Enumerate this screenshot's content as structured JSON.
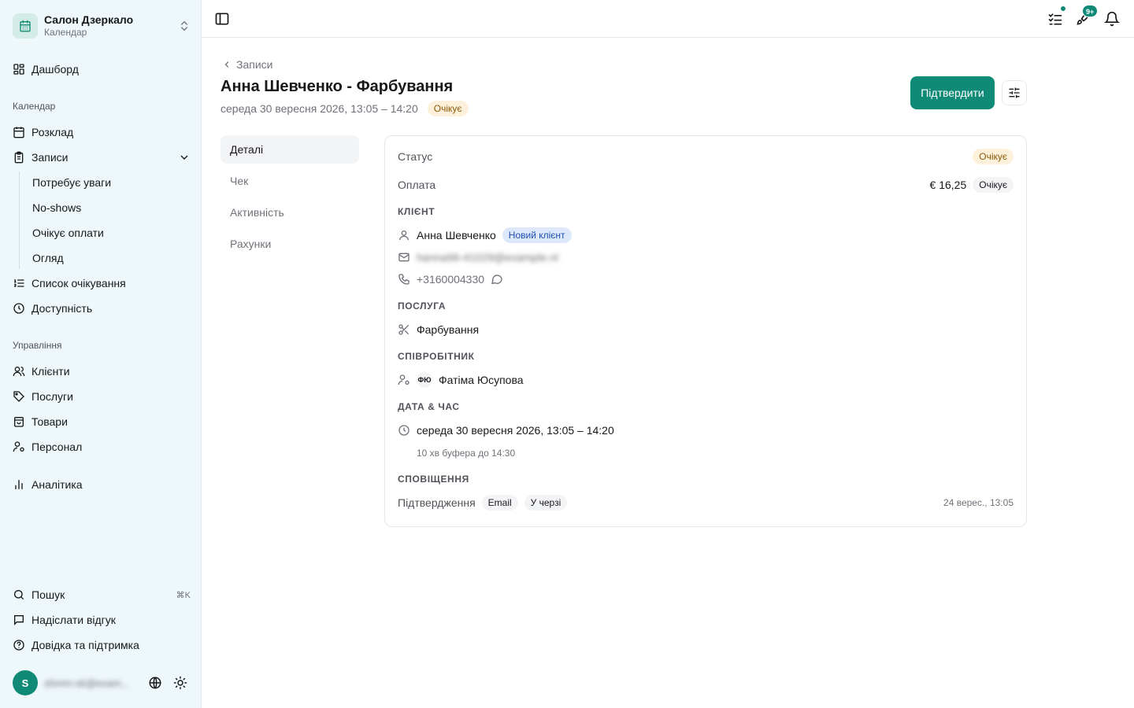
{
  "org": {
    "name": "Салон Дзеркало",
    "subtitle": "Календар"
  },
  "nav": {
    "dashboard": "Дашборд",
    "calendar_section": "Календар",
    "schedule": "Розклад",
    "records": "Записи",
    "records_sub": [
      "Потребує уваги",
      "No-shows",
      "Очікує оплати",
      "Огляд"
    ],
    "waitlist": "Список очікування",
    "availability": "Доступність",
    "manage_section": "Управління",
    "clients": "Клієнти",
    "services": "Послуги",
    "products": "Товари",
    "staff": "Персонал",
    "analytics": "Аналітика",
    "search": "Пошук",
    "search_kbd": "⌘K",
    "feedback": "Надіслати відгук",
    "help": "Довідка та підтримка"
  },
  "user": {
    "initial": "S",
    "email": "shmm-sk@exam..."
  },
  "topbar": {
    "notif_count": "9+"
  },
  "header": {
    "back_label": "Записи",
    "title": "Анна Шевченко - Фарбування",
    "datetime": "середа 30 вересня 2026, 13:05 – 14:20",
    "status": "Очікує",
    "confirm_label": "Підтвердити"
  },
  "tabs": [
    "Деталі",
    "Чек",
    "Активність",
    "Рахунки"
  ],
  "details": {
    "status_label": "Статус",
    "status_value": "Очікує",
    "payment_label": "Оплата",
    "payment_amount": "€ 16,25",
    "payment_status": "Очікує",
    "client_section": "КЛІЄНТ",
    "client_name": "Анна Шевченко",
    "client_badge": "Новий клієнт",
    "client_email": "hanna96-41029@example.nl",
    "client_phone": "+3160004330",
    "service_section": "ПОСЛУГА",
    "service_name": "Фарбування",
    "staff_section": "СПІВРОБІТНИК",
    "staff_initials": "ФЮ",
    "staff_name": "Фатіма Юсупова",
    "datetime_section": "ДАТА & ЧАС",
    "datetime_value": "середа 30 вересня 2026, 13:05 – 14:20",
    "buffer_note": "10 хв буфера до 14:30",
    "notif_section": "СПОВІЩЕННЯ",
    "notif_label": "Підтвердження",
    "notif_channel": "Email",
    "notif_status": "У черзі",
    "notif_time": "24 верес., 13:05"
  },
  "colors": {
    "accent": "#0f8a76",
    "sidebar_bg": "#eef7fa",
    "warn_bg": "#fdf1dc",
    "info_bg": "#dde9fb"
  },
  "icons": {
    "org": "calendar-icon",
    "dashboard": "grid-icon",
    "schedule": "calendar-icon",
    "records": "clipboard-icon",
    "waitlist": "list-ordered-icon",
    "availability": "clock-icon",
    "clients": "users-icon",
    "services": "tag-icon",
    "products": "shopping-bag-icon",
    "staff": "user-cog-icon",
    "analytics": "bar-chart-icon",
    "search": "search-icon",
    "feedback": "message-square-icon",
    "help": "help-circle-icon"
  }
}
